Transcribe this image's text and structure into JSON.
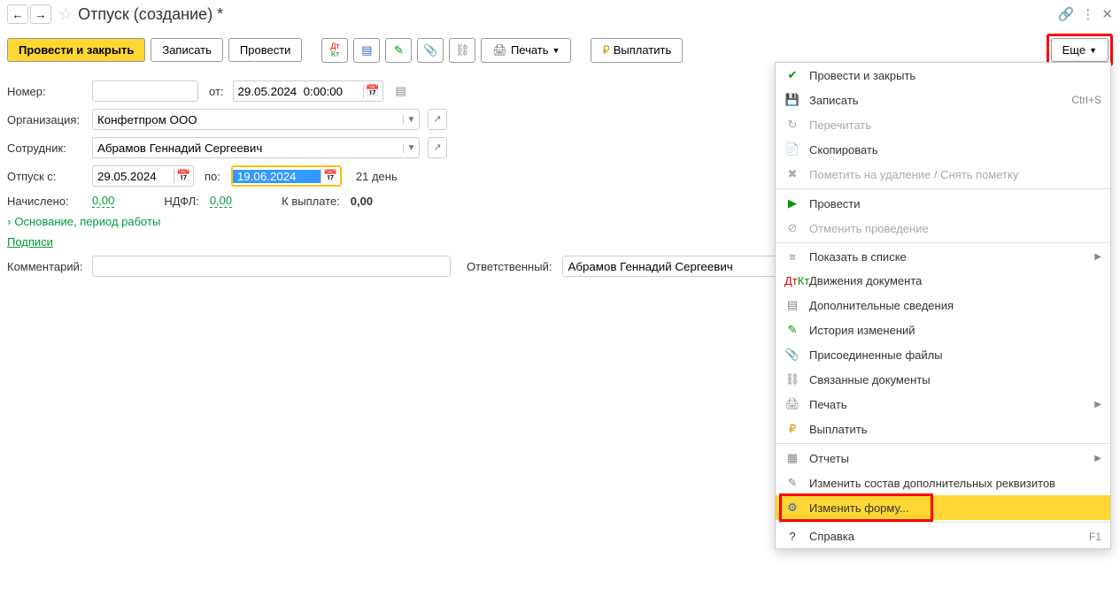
{
  "header": {
    "title": "Отпуск (создание) *"
  },
  "toolbar": {
    "post_close": "Провести и закрыть",
    "save": "Записать",
    "post": "Провести",
    "print": "Печать",
    "pay": "Выплатить",
    "more": "Еще"
  },
  "form": {
    "number_label": "Номер:",
    "number_value": "",
    "from_label": "от:",
    "from_date": "29.05.2024  0:00:00",
    "org_label": "Организация:",
    "org_value": "Конфетпром ООО",
    "emp_label": "Сотрудник:",
    "emp_value": "Абрамов Геннадий Сергеевич",
    "vac_from_label": "Отпуск с:",
    "vac_from": "29.05.2024",
    "vac_to_label": "по:",
    "vac_to": "19.06.2024",
    "days": "21 день",
    "accrued_label": "Начислено:",
    "accrued_value": "0,00",
    "ndfl_label": "НДФЛ:",
    "ndfl_value": "0,00",
    "topay_label": "К выплате:",
    "topay_value": "0,00",
    "basis_section": "Основание, период работы",
    "signs": "Подписи",
    "comment_label": "Комментарий:",
    "comment_value": "",
    "resp_label": "Ответственный:",
    "resp_value": "Абрамов Геннадий Сергеевич"
  },
  "menu": {
    "items": [
      {
        "icon": "✔",
        "label": "Провести и закрыть",
        "iconColor": "#090"
      },
      {
        "icon": "💾",
        "label": "Записать",
        "shortcut": "Ctrl+S",
        "iconColor": "#888"
      },
      {
        "icon": "↻",
        "label": "Перечитать",
        "disabled": true,
        "iconColor": "#aaa"
      },
      {
        "icon": "📄",
        "label": "Скопировать",
        "iconColor": "#090"
      },
      {
        "icon": "✖",
        "label": "Пометить на удаление / Снять пометку",
        "disabled": true,
        "iconColor": "#aaa"
      },
      {
        "sep": true
      },
      {
        "icon": "▶",
        "label": "Провести",
        "iconColor": "#090"
      },
      {
        "icon": "⊘",
        "label": "Отменить проведение",
        "disabled": true,
        "iconColor": "#aaa"
      },
      {
        "sep": true
      },
      {
        "icon": "≡",
        "label": "Показать в списке",
        "arrow": true,
        "iconColor": "#888"
      },
      {
        "icon": "Дт",
        "label": "Движения документа",
        "dtkt": true
      },
      {
        "icon": "▤",
        "label": "Дополнительные сведения",
        "iconColor": "#888"
      },
      {
        "icon": "✎",
        "label": "История изменений",
        "iconColor": "#090"
      },
      {
        "icon": "📎",
        "label": "Присоединенные файлы",
        "iconColor": "#888"
      },
      {
        "icon": "⛓",
        "label": "Связанные документы",
        "iconColor": "#888"
      },
      {
        "icon": "🖨",
        "label": "Печать",
        "arrow": true,
        "iconColor": "#888"
      },
      {
        "icon": "₽",
        "label": "Выплатить",
        "iconColor": "#d90"
      },
      {
        "sep": true
      },
      {
        "icon": "▦",
        "label": "Отчеты",
        "arrow": true,
        "iconColor": "#888"
      },
      {
        "icon": "✎",
        "label": "Изменить состав дополнительных реквизитов",
        "iconColor": "#888"
      },
      {
        "icon": "⚙",
        "label": "Изменить форму...",
        "highlighted": true,
        "iconColor": "#36c"
      },
      {
        "sep": true
      },
      {
        "icon": "?",
        "label": "Справка",
        "shortcut": "F1",
        "iconColor": "#333"
      }
    ]
  }
}
